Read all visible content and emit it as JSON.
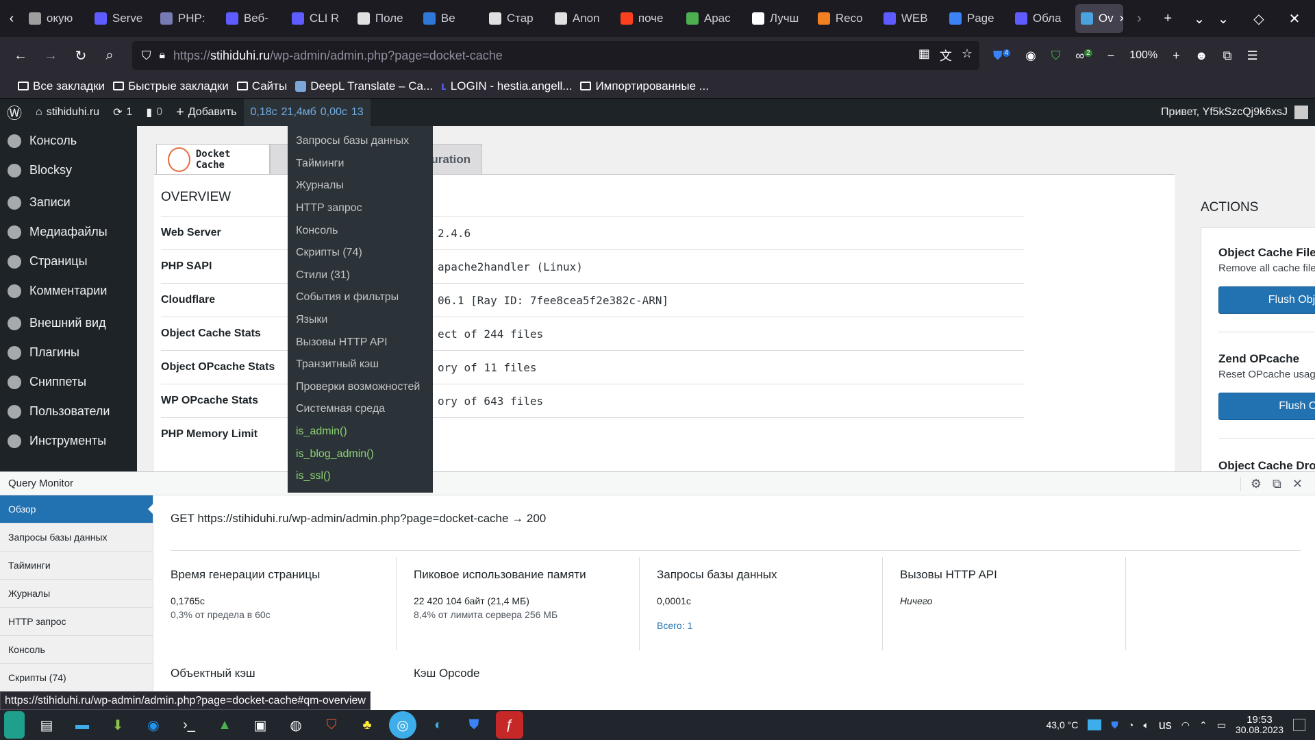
{
  "browser": {
    "tabs": [
      {
        "label": "окую",
        "color": "#9e9e9e"
      },
      {
        "label": "Serve",
        "color": "#5e5cff"
      },
      {
        "label": "PHP:",
        "color": "#777bb3"
      },
      {
        "label": "Веб-",
        "color": "#5e5cff"
      },
      {
        "label": "CLI R",
        "color": "#5e5cff"
      },
      {
        "label": "Поле",
        "color": "#e0e0e0"
      },
      {
        "label": "Ве",
        "color": "#2f78d8"
      },
      {
        "label": "Стар",
        "color": "#e0e0e0"
      },
      {
        "label": "Anon",
        "color": "#e0e0e0"
      },
      {
        "label": "поче",
        "color": "#fc3f1d"
      },
      {
        "label": "Apac",
        "color": "#4caf50"
      },
      {
        "label": "Лучш",
        "color": "#ffffff"
      },
      {
        "label": "Reco",
        "color": "#f38020"
      },
      {
        "label": "WEB",
        "color": "#5e5cff"
      },
      {
        "label": "Page",
        "color": "#3b82f6"
      },
      {
        "label": "Обла",
        "color": "#5e5cff"
      }
    ],
    "active_tab": {
      "label": "Ov",
      "close": "✕"
    },
    "new_tab": "+",
    "url_scheme": "https://",
    "url_domain": "stihiduhi.ru",
    "url_path": "/wp-admin/admin.php?page=docket-cache",
    "zoom": "100%",
    "badges": {
      "ublock": "4",
      "ext": "2"
    },
    "bookmarks": [
      "Все закладки",
      "Быстрые закладки",
      "Сайты",
      "DeepL Translate – Ca...",
      "LOGIN - hestia.angell...",
      "Импортированные ..."
    ],
    "status_url": "https://stihiduhi.ru/wp-admin/admin.php?page=docket-cache#qm-overview"
  },
  "adminbar": {
    "site": "stihiduhi.ru",
    "updates": "1",
    "comments": "0",
    "add_new": "Добавить",
    "qm_time": "0,18с",
    "qm_mem": "21,4мб",
    "qm_db": "0,00с",
    "qm_count": "13",
    "greeting": "Привет, Yf5kSzcQj9k6xsJ"
  },
  "sidemenu": [
    "Консоль",
    "Blocksy",
    "Записи",
    "Медиафайлы",
    "Страницы",
    "Комментарии",
    "Внешний вид",
    "Плагины",
    "Сниппеты",
    "Пользователи",
    "Инструменты"
  ],
  "qm_dropdown": [
    "Запросы базы данных",
    "Тайминги",
    "Журналы",
    "HTTP запрос",
    "Консоль",
    "Скрипты (74)",
    "Стили (31)",
    "События и фильтры",
    "Языки",
    "Вызовы HTTP API",
    "Транзитный кэш",
    "Проверки возможностей",
    "Системная среда"
  ],
  "qm_dropdown_green": [
    "is_admin()",
    "is_blog_admin()",
    "is_ssl()"
  ],
  "docket": {
    "brand": "Docket Cache",
    "tab2_partial": "uration",
    "overview_title": "OVERVIEW",
    "rows": [
      {
        "k": "Web Server",
        "v": "2.4.6"
      },
      {
        "k": "PHP SAPI",
        "v": "apache2handler (Linux)"
      },
      {
        "k": "Cloudflare",
        "v": "06.1 [Ray ID: 7fee8cea5f2e382c-ARN]"
      },
      {
        "k": "Object Cache Stats",
        "v": "ect of 244 files"
      },
      {
        "k": "Object OPcache Stats",
        "v": "ory of 11 files"
      },
      {
        "k": "WP OPcache Stats",
        "v": "ory of 643 files"
      },
      {
        "k": "PHP Memory Limit",
        "v": ""
      }
    ],
    "actions_title": "ACTIONS",
    "actions": [
      {
        "title": "Object Cache Files",
        "desc": "Remove all cache files.",
        "button": "Flush Object Cache"
      },
      {
        "title": "Zend OPcache",
        "desc": "Reset OPcache usage.",
        "button": "Flush OPcache"
      },
      {
        "title": "Object Cache Drop-In",
        "desc": "",
        "button": ""
      }
    ]
  },
  "qm_panel": {
    "title": "Query Monitor",
    "nav": [
      "Обзор",
      "Запросы базы данных",
      "Тайминги",
      "Журналы",
      "HTTP запрос",
      "Консоль",
      "Скрипты (74)"
    ],
    "request": "GET https://stihiduhi.ru/wp-admin/admin.php?page=docket-cache → 200",
    "sections": [
      {
        "title": "Время генерации страницы",
        "a": "0,1765с",
        "b": "0,3% от предела в 60с"
      },
      {
        "title": "Пиковое использование памяти",
        "a": "22 420 104 байт (21,4 МБ)",
        "b": "8,4% от лимита сервера 256 МБ"
      },
      {
        "title": "Запросы базы данных",
        "a": "0,0001с",
        "link": "Всего: 1"
      },
      {
        "title": "Вызовы HTTP API",
        "italic": "Ничего"
      }
    ],
    "sections2": [
      "Объектный кэш",
      "Кэш Opcode"
    ]
  },
  "taskbar": {
    "temp": "43,0 °C",
    "lang": "us",
    "time": "19:53",
    "date": "30.08.2023"
  }
}
